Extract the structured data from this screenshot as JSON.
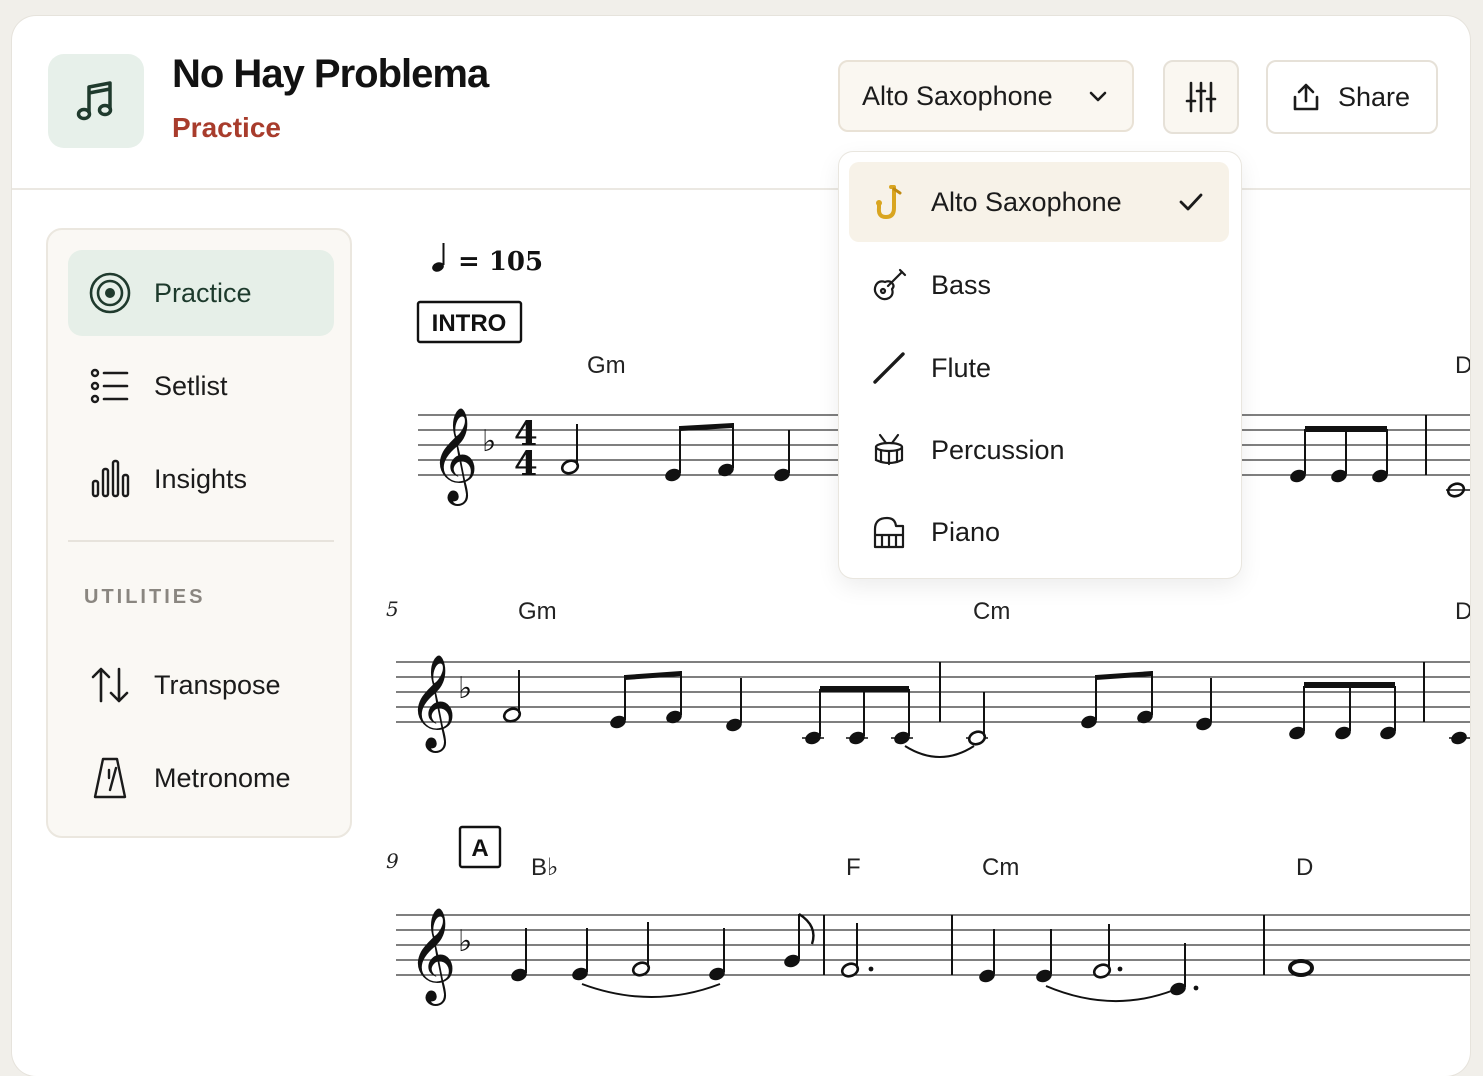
{
  "header": {
    "song_title": "No Hay Problema",
    "mode_label": "Practice",
    "instrument_selected": "Alto Saxophone",
    "share_label": "Share"
  },
  "sidebar": {
    "items": [
      {
        "label": "Practice",
        "icon": "target-icon",
        "active": true
      },
      {
        "label": "Setlist",
        "icon": "list-icon",
        "active": false
      },
      {
        "label": "Insights",
        "icon": "bar-chart-icon",
        "active": false
      }
    ],
    "utilities_label": "UTILITIES",
    "utilities": [
      {
        "label": "Transpose",
        "icon": "transpose-arrows-icon"
      },
      {
        "label": "Metronome",
        "icon": "metronome-icon"
      }
    ]
  },
  "dropdown": {
    "options": [
      {
        "label": "Alto Saxophone",
        "icon": "saxophone-icon",
        "selected": true
      },
      {
        "label": "Bass",
        "icon": "guitar-icon",
        "selected": false
      },
      {
        "label": "Flute",
        "icon": "flute-icon",
        "selected": false
      },
      {
        "label": "Percussion",
        "icon": "drum-icon",
        "selected": false
      },
      {
        "label": "Piano",
        "icon": "piano-icon",
        "selected": false
      }
    ]
  },
  "score": {
    "tempo": "= 105",
    "intro_label": "INTRO",
    "rehearsal_a": "A",
    "system1": {
      "chords": [
        "Gm",
        "D"
      ],
      "time_sig_top": "4",
      "time_sig_bottom": "4"
    },
    "system2": {
      "measure_number": "5",
      "chords": [
        "Gm",
        "Cm",
        "D"
      ]
    },
    "system3": {
      "measure_number": "9",
      "chords": [
        "B♭",
        "F",
        "Cm",
        "D"
      ]
    }
  },
  "colors": {
    "accent_red": "#a83c2c",
    "active_green_bg": "#e6efe8",
    "sax_gold": "#d9a520"
  }
}
